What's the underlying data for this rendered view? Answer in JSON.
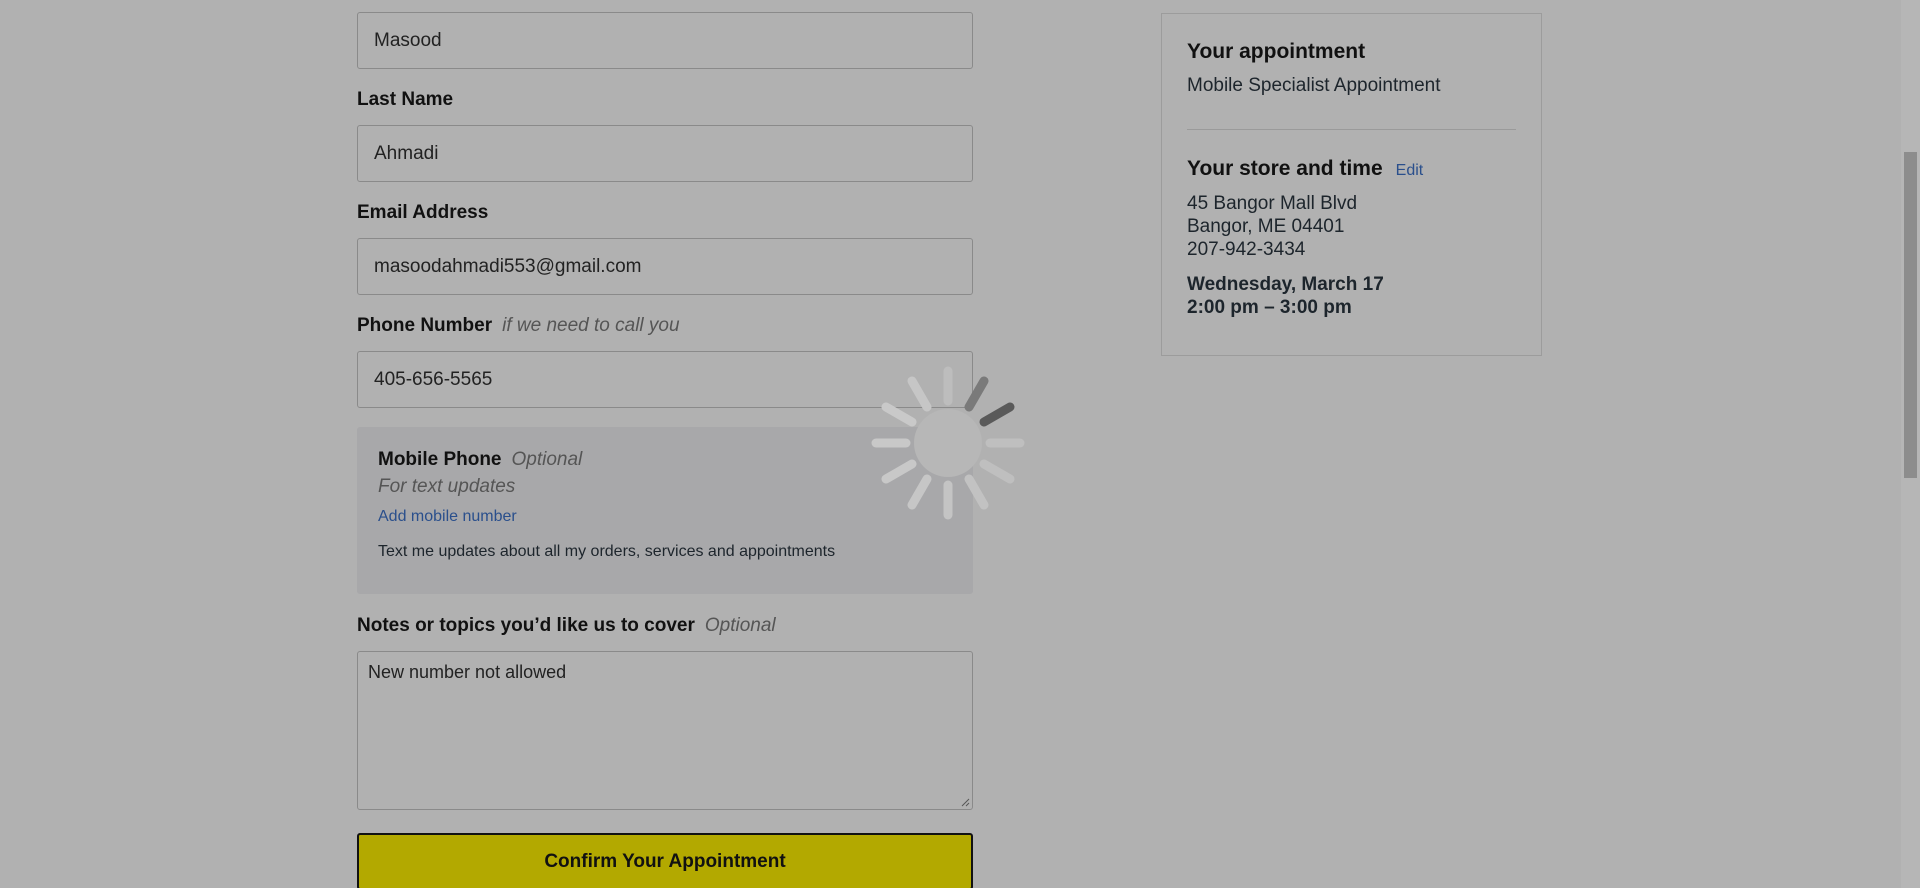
{
  "form": {
    "first_name_value": "Masood",
    "last_name_label": "Last Name",
    "last_name_value": "Ahmadi",
    "email_label": "Email Address",
    "email_value": "masoodahmadi553@gmail.com",
    "phone_label": "Phone Number",
    "phone_hint": "if we need to call you",
    "phone_value": "405-656-5565",
    "mobile": {
      "title": "Mobile Phone",
      "optional": "Optional",
      "subtitle": "For text updates",
      "add_link": "Add mobile number",
      "note": "Text me updates about all my orders, services and appointments"
    },
    "notes_label": "Notes or topics you’d like us to cover",
    "notes_optional": "Optional",
    "notes_value": "New number not allowed",
    "confirm_label": "Confirm Your Appointment"
  },
  "summary": {
    "appointment_heading": "Your appointment",
    "appointment_name": "Mobile Specialist Appointment",
    "store_heading": "Your store and time",
    "edit_label": "Edit",
    "address_line1": "45 Bangor Mall Blvd",
    "address_line2": "Bangor, ME 04401",
    "phone": "207-942-3434",
    "date": "Wednesday, March 17",
    "time": "2:00 pm – 3:00 pm"
  },
  "colors": {
    "overlay_bg": "#b1b1b1",
    "confirm_button": "#b3a900",
    "link": "#2a4f8c"
  },
  "icons": {
    "spinner": "loading-spinner-icon"
  }
}
